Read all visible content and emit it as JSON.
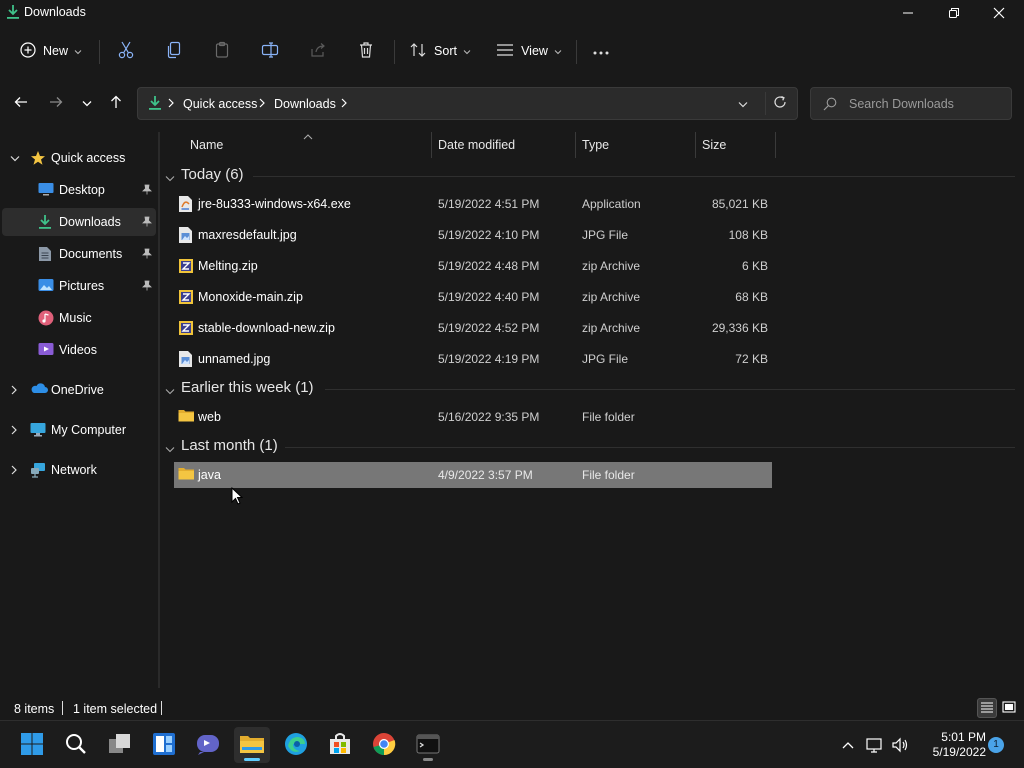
{
  "window": {
    "title": "Downloads",
    "minimize_icon": "minimize-icon",
    "maximize_icon": "restore-icon",
    "close_icon": "close-icon"
  },
  "commandbar": {
    "new_label": "New",
    "sort_label": "Sort",
    "view_label": "View",
    "icons": [
      "plus-circle-icon",
      "cut-icon",
      "copy-icon",
      "paste-icon",
      "rename-icon",
      "share-icon",
      "delete-icon",
      "sort-icon",
      "view-icon",
      "more-icon"
    ]
  },
  "address": {
    "crumbs": [
      "Quick access",
      "Downloads"
    ],
    "search_placeholder": "Search Downloads"
  },
  "sidebar": {
    "quick_access": "Quick access",
    "items": [
      {
        "label": "Desktop",
        "icon": "desktop-icon",
        "pinned": true
      },
      {
        "label": "Downloads",
        "icon": "downloads-icon",
        "pinned": true,
        "selected": true
      },
      {
        "label": "Documents",
        "icon": "documents-icon",
        "pinned": true
      },
      {
        "label": "Pictures",
        "icon": "pictures-icon",
        "pinned": true
      },
      {
        "label": "Music",
        "icon": "music-icon",
        "pinned": false
      },
      {
        "label": "Videos",
        "icon": "videos-icon",
        "pinned": false
      }
    ],
    "onedrive": "OneDrive",
    "mycomputer": "My Computer",
    "network": "Network"
  },
  "columns": {
    "name": "Name",
    "date": "Date modified",
    "type": "Type",
    "size": "Size"
  },
  "groups": [
    {
      "label": "Today (6)",
      "files": [
        {
          "name": "jre-8u333-windows-x64.exe",
          "date": "5/19/2022 4:51 PM",
          "type": "Application",
          "size": "85,021 KB",
          "icon": "exe-icon"
        },
        {
          "name": "maxresdefault.jpg",
          "date": "5/19/2022 4:10 PM",
          "type": "JPG File",
          "size": "108 KB",
          "icon": "image-file-icon"
        },
        {
          "name": "Melting.zip",
          "date": "5/19/2022 4:48 PM",
          "type": "zip Archive",
          "size": "6 KB",
          "icon": "zip-icon"
        },
        {
          "name": "Monoxide-main.zip",
          "date": "5/19/2022 4:40 PM",
          "type": "zip Archive",
          "size": "68 KB",
          "icon": "zip-icon"
        },
        {
          "name": "stable-download-new.zip",
          "date": "5/19/2022 4:52 PM",
          "type": "zip Archive",
          "size": "29,336 KB",
          "icon": "zip-icon"
        },
        {
          "name": "unnamed.jpg",
          "date": "5/19/2022 4:19 PM",
          "type": "JPG File",
          "size": "72 KB",
          "icon": "image-file-icon"
        }
      ]
    },
    {
      "label": "Earlier this week (1)",
      "files": [
        {
          "name": "web",
          "date": "5/16/2022 9:35 PM",
          "type": "File folder",
          "size": "",
          "icon": "folder-icon"
        }
      ]
    },
    {
      "label": "Last month (1)",
      "files": [
        {
          "name": "java",
          "date": "4/9/2022 3:57 PM",
          "type": "File folder",
          "size": "",
          "icon": "folder-icon",
          "selected": true
        }
      ]
    }
  ],
  "status": {
    "count": "8 items",
    "selection": "1 item selected"
  },
  "taskbar": {
    "apps": [
      "start-icon",
      "search-icon",
      "task-view-icon",
      "widgets-icon",
      "teams-chat-icon",
      "file-explorer-icon",
      "edge-icon",
      "store-icon",
      "chrome-icon",
      "terminal-icon"
    ],
    "time": "5:01 PM",
    "date": "5/19/2022",
    "notification_count": "1"
  },
  "colors": {
    "background": "#191919",
    "accent": "#60cdff",
    "selection": "#777777",
    "folder": "#f4c542"
  }
}
